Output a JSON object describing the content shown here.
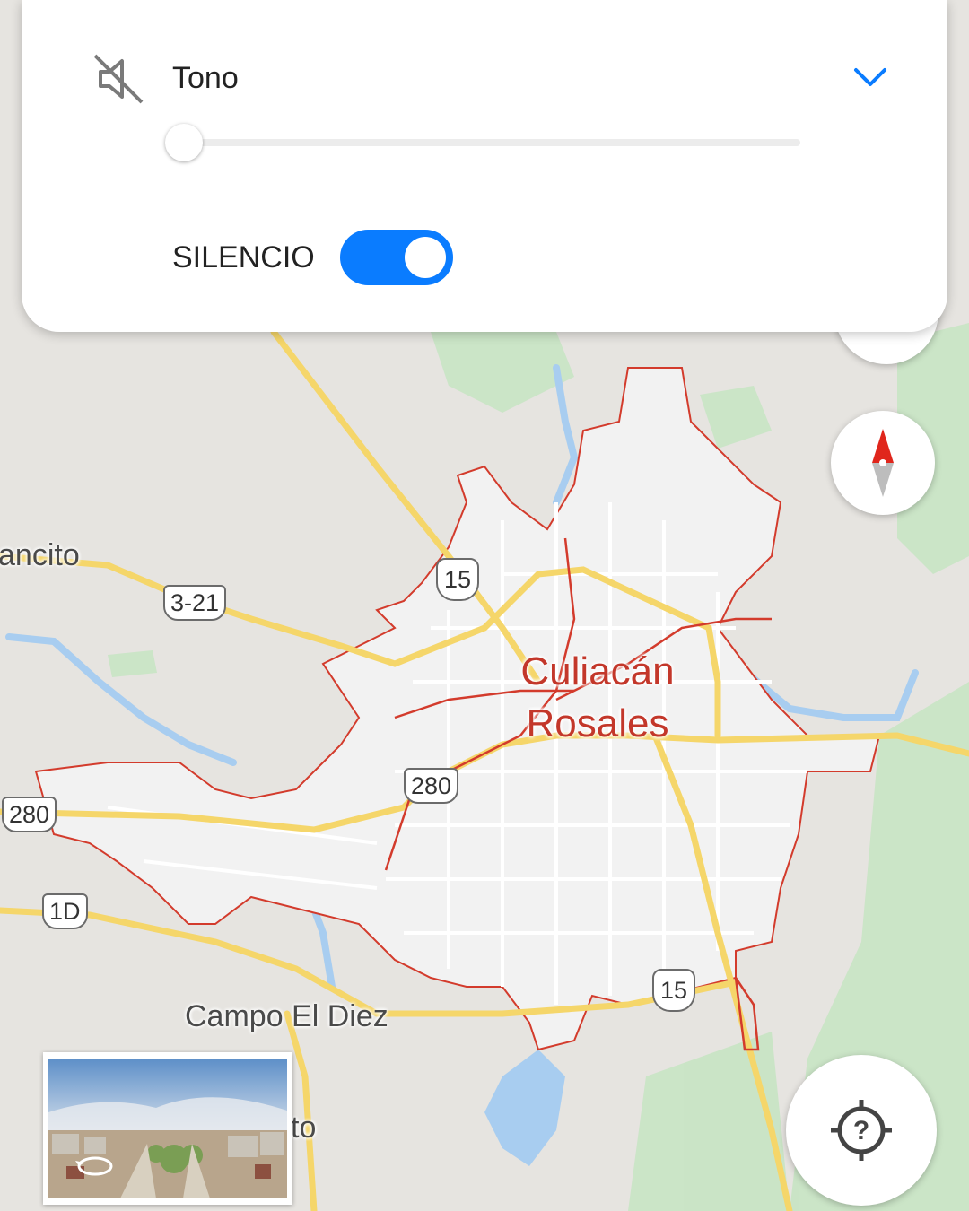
{
  "sound_panel": {
    "tone_label": "Tono",
    "tone_level": 0,
    "silence_label": "SILENCIO",
    "silence_enabled": true,
    "icons": {
      "mute": "mute-icon",
      "expand": "chevron-down-icon"
    }
  },
  "map": {
    "city_name_line1": "Culiacán",
    "city_name_line2": "Rosales",
    "places": {
      "campo": "Campo El Diez",
      "left_edge": "ancito",
      "bottom_partial": "to"
    },
    "route_shields": {
      "r15_top": "15",
      "r3_21": "3-21",
      "r280_center": "280",
      "r280_left": "280",
      "r1d": "1D",
      "r15_bottom": "15"
    },
    "colors": {
      "city_border": "#d33b2c",
      "highway": "#f5d66a",
      "water": "#a8cdf0",
      "park": "#c6e6c2",
      "urban": "#f2f2f2",
      "toggle_on": "#0a7cff"
    }
  },
  "controls": {
    "compass": "compass-icon",
    "my_location": "location-help-icon",
    "street_view": "street-view-rotate-icon"
  }
}
